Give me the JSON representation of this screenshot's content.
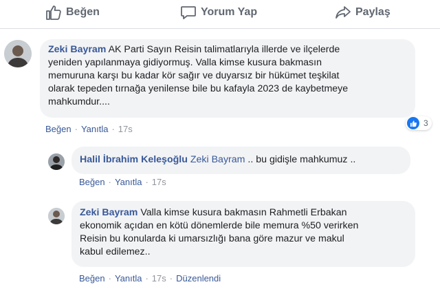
{
  "actions": {
    "like_label": "Beğen",
    "comment_label": "Yorum Yap",
    "share_label": "Paylaş"
  },
  "comments": [
    {
      "author": "Zeki Bayram",
      "text_lines": [
        "AK Parti Sayın Reisin talimatlarıyla illerde ve ilçelerde",
        "yeniden yapılanmaya gidiyormuş. Valla kimse kusura bakmasın",
        "memuruna karşı bu kadar kör sağır ve duyarsız bir hükümet teşkilat",
        "olarak tepeden tırnağa yenilense bile bu kafayla 2023 de kaybetmeye",
        "mahkumdur...."
      ],
      "like_link": "Beğen",
      "reply_link": "Yanıtla",
      "time": "17s",
      "reaction_count": "3",
      "reaction_icon": "like-icon"
    }
  ],
  "replies": [
    {
      "author": "Halil İbrahim Keleşoğlu",
      "mention": "Zeki Bayram",
      "text_lines": [
        ".. bu gidişle mahkumuz .."
      ],
      "like_link": "Beğen",
      "reply_link": "Yanıtla",
      "time": "17s"
    },
    {
      "author": "Zeki Bayram",
      "text_lines": [
        "Valla kimse kusura bakmasın Rahmetli Erbakan",
        "ekonomik açıdan en kötü dönemlerde bile memura %50 verirken",
        "Reisin bu konularda ki umarsızlığı bana göre mazur ve makul",
        "kabul edilemez.."
      ],
      "like_link": "Beğen",
      "reply_link": "Yanıtla",
      "time": "17s",
      "edited": "Düzenlendi"
    }
  ],
  "colors": {
    "link": "#385898",
    "bubble": "#f2f3f5",
    "muted": "#606770",
    "reaction": "#1877f2"
  }
}
